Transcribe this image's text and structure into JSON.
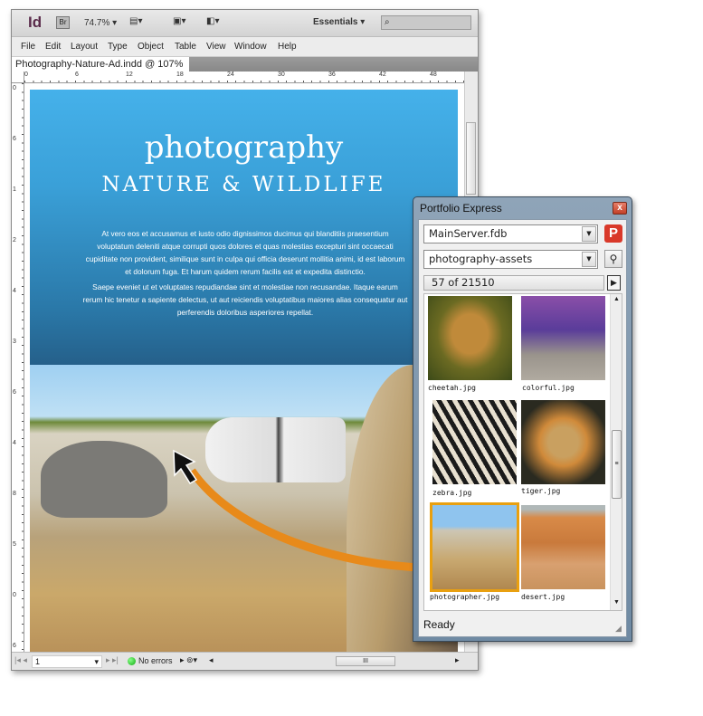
{
  "app": {
    "logo": "Id",
    "bridge": "Br",
    "zoom": "74.7%",
    "workspace": "Essentials",
    "search_placeholder": ""
  },
  "menu": [
    "File",
    "Edit",
    "Layout",
    "Type",
    "Object",
    "Table",
    "View",
    "Window",
    "Help"
  ],
  "document": {
    "tab": "Photography-Nature-Ad.indd @ 107%",
    "hruler": [
      "0",
      "6",
      "12",
      "18",
      "24",
      "30",
      "36",
      "42",
      "48"
    ],
    "vruler": [
      "0",
      "6",
      "1",
      "2",
      "4",
      "3",
      "6",
      "4",
      "8",
      "5",
      "0",
      "6"
    ]
  },
  "page": {
    "title": "photography",
    "subtitle": "NATURE & WILDLIFE",
    "body1": "At vero eos et accusamus et iusto odio dignissimos ducimus qui blanditiis praesentium voluptatum deleniti atque corrupti quos dolores et quas molestias excepturi sint occaecati cupiditate non provident, similique sunt in culpa qui officia deserunt mollitia animi, id est laborum et dolorum fuga. Et harum quidem rerum facilis est et expedita distinctio.",
    "body2": "Saepe eveniet ut et voluptates repudiandae sint et molestiae non recusandae. Itaque earum rerum hic tenetur a sapiente delectus, ut aut reiciendis voluptatibus maiores alias consequatur aut perferendis doloribus asperiores repellat."
  },
  "statusbar": {
    "page": "1",
    "preflight": "No errors",
    "hscroll_grip": "III"
  },
  "portfolio": {
    "title": "Portfolio Express",
    "close": "x",
    "server": "MainServer.fdb",
    "logo": "P",
    "catalog": "photography-assets",
    "count": "57 of 21510",
    "status": "Ready",
    "items": [
      {
        "name": "cheetah.jpg",
        "selected": false
      },
      {
        "name": "colorful.jpg",
        "selected": false
      },
      {
        "name": "zebra.jpg",
        "selected": false
      },
      {
        "name": "tiger.jpg",
        "selected": false
      },
      {
        "name": "photographer.jpg",
        "selected": true
      },
      {
        "name": "desert.jpg",
        "selected": false
      }
    ]
  },
  "colors": {
    "accent": "#e9a010",
    "panel_blue": "#45b1ea",
    "drag_arrow": "#e88a1a"
  }
}
